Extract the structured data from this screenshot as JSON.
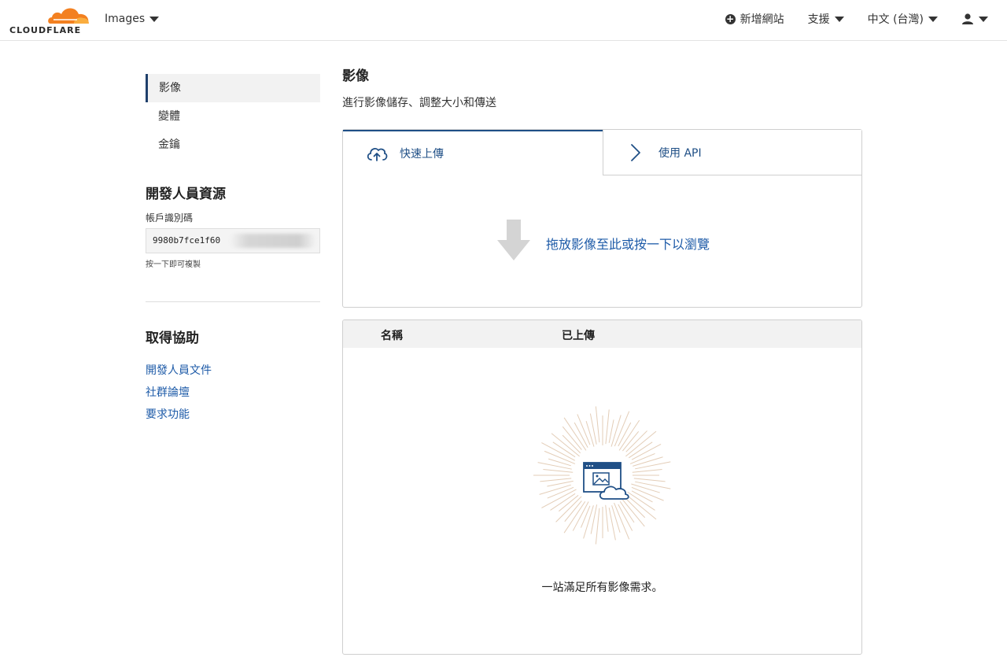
{
  "header": {
    "logo_text": "CLOUDFLARE",
    "product": "Images",
    "add_site": "新增網站",
    "support": "支援",
    "language": "中文 (台灣)"
  },
  "sidebar": {
    "items": [
      {
        "label": "影像",
        "active": true
      },
      {
        "label": "變體",
        "active": false
      },
      {
        "label": "金鑰",
        "active": false
      }
    ],
    "dev_heading": "開發人員資源",
    "account_id_label": "帳戶識別碼",
    "account_id_value": "9980b7fce1f60",
    "copy_hint": "按一下即可複製",
    "help_heading": "取得協助",
    "help_links": [
      "開發人員文件",
      "社群論壇",
      "要求功能"
    ]
  },
  "main": {
    "title": "影像",
    "subtitle": "進行影像儲存、調整大小和傳送",
    "tabs": {
      "upload": "快速上傳",
      "api": "使用 API"
    },
    "dropzone_text": "拖放影像至此或按一下以瀏覽",
    "table": {
      "col_name": "名稱",
      "col_uploaded": "已上傳"
    },
    "empty_text": "一站滿足所有影像需求。"
  },
  "colors": {
    "brand_orange": "#f38020",
    "link_blue": "#1e5ba8",
    "tab_blue": "#1f4f86",
    "burst": "#e3cdb7"
  }
}
